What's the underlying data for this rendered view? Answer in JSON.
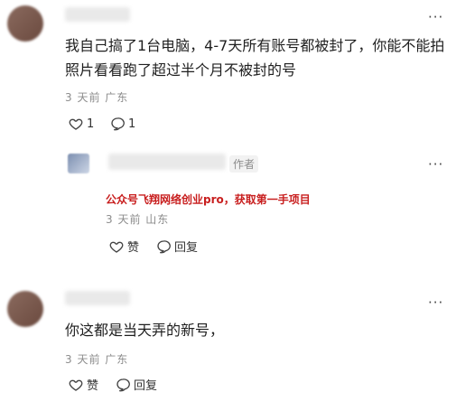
{
  "comments": [
    {
      "text": "我自己搞了1台电脑，4-7天所有账号都被封了，你能不能拍照片看看跑了超过半个月不被封的号",
      "meta": "3 天前 广东",
      "like_count": "1",
      "reply_count": "1",
      "more": "···"
    },
    {
      "author_tag": "作者",
      "watermark": "公众号飞翔网络创业pro，获取第一手项目",
      "meta": "3 天前 山东",
      "like_label": "赞",
      "reply_label": "回复",
      "more": "···"
    },
    {
      "text": "你这都是当天弄的新号，",
      "meta": "3 天前 广东",
      "like_label": "赞",
      "reply_label": "回复",
      "more": "···"
    }
  ]
}
